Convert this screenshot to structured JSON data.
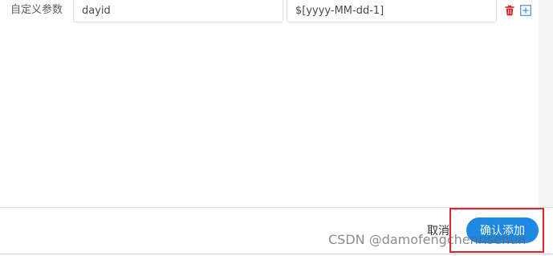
{
  "param_row": {
    "label": "自定义参数",
    "name_value": "dayid",
    "value_value": "$[yyyy-MM-dd-1]"
  },
  "footer": {
    "cancel_label": "取消",
    "confirm_label": "确认添加"
  },
  "watermark": {
    "text": "CSDN @damofengchenrisehun"
  },
  "colors": {
    "accent": "#1e88e5",
    "delete_icon": "#e02020",
    "add_icon": "#4a90d9",
    "highlight": "#e0242c"
  },
  "icons": {
    "delete": "trash-icon",
    "add": "plus-square-icon"
  }
}
